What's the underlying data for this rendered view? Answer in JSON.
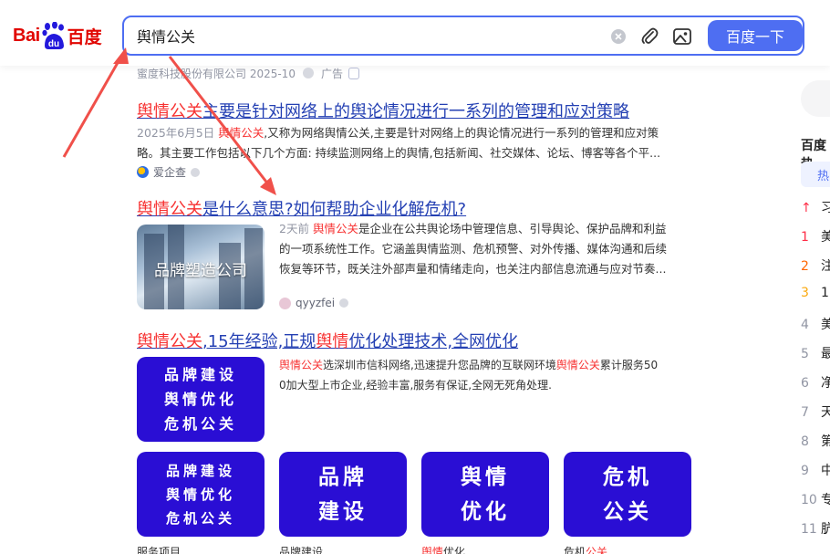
{
  "header": {
    "logo": {
      "bai": "Bai",
      "du": "du",
      "brand": "百度"
    },
    "search": {
      "value": "舆情公关"
    },
    "search_button_label": "百度一下"
  },
  "ad": {
    "company": "蜜度科技股份有限公司 2025-10",
    "ad_label": "广告"
  },
  "results": [
    {
      "title_hl": "舆情公关",
      "title_rest": "主要是针对网络上的舆论情况进行一系列的管理和应对策略",
      "snippet_line1_date": "2025年6月5日",
      "snippet_line1_hl": "舆情公关",
      "snippet_line1_rest": ",又称为网络舆情公关,主要是针对网络上的舆论情况进行一系列的管理和应对策",
      "snippet_line2": "略。其主要工作包括以下几个方面: 持续监测网络上的舆情,包括新闻、社交媒体、论坛、博客等各个平...",
      "source": "爱企查"
    },
    {
      "title_hl": "舆情公关",
      "title_rest": "是什么意思?如何帮助企业化解危机?",
      "thumb_text": "品牌塑造公司",
      "snippet_line1_date": "2天前",
      "snippet_line1_hl": "舆情公关",
      "snippet_line1_rest": "是企业在公共舆论场中管理信息、引导舆论、保护品牌和利益",
      "snippet_line2": "的一项系统性工作。它涵盖舆情监测、危机预警、对外传播、媒体沟通和后续",
      "snippet_line3": "恢复等环节，既关注外部声量和情绪走向，也关注内部信息流通与应对节奏...",
      "source": "qyyzfei"
    },
    {
      "title_hl1": "舆情公关",
      "title_mid": ",15年经验,正规",
      "title_hl2": "舆情",
      "title_rest": "优化处理技术,全网优化",
      "snippet_hl1": "舆情公关",
      "snippet_mid": "选深圳市信科网络,迅速提升您品牌的互联网环境",
      "snippet_hl2": "舆情公关",
      "snippet_rest": "累计服务50",
      "snippet_line2": "0加大型上市企业,经验丰富,服务有保证,全网无死角处理.",
      "tile_main": [
        "品牌建设",
        "舆情优化",
        "危机公关"
      ],
      "tiles": [
        {
          "lines": [
            "品牌建设",
            "舆情优化",
            "危机公关"
          ],
          "caption": "服务项目"
        },
        {
          "lines": [
            "品牌",
            "建设"
          ],
          "caption": "品牌建设"
        },
        {
          "lines": [
            "舆情",
            "优化"
          ],
          "caption_hl": "舆情",
          "caption_rest": "优化"
        },
        {
          "lines": [
            "危机",
            "公关"
          ],
          "caption_pre": "危机",
          "caption_hl": "公关"
        }
      ]
    }
  ],
  "sidebar": {
    "title": "百度热",
    "tab": "热",
    "ranks": [
      {
        "n": "",
        "t": "习"
      },
      {
        "n": "1",
        "t": "美"
      },
      {
        "n": "2",
        "t": "注"
      },
      {
        "n": "3",
        "t": "1"
      },
      {
        "n": "4",
        "t": "美"
      },
      {
        "n": "5",
        "t": "最"
      },
      {
        "n": "6",
        "t": "净"
      },
      {
        "n": "7",
        "t": "天"
      },
      {
        "n": "8",
        "t": "第"
      },
      {
        "n": "9",
        "t": "中"
      },
      {
        "n": "10",
        "t": "专"
      },
      {
        "n": "11",
        "t": "肮"
      }
    ]
  },
  "colors": {
    "accent": "#4e6ef2",
    "brand_red": "#e10601",
    "highlight": "#f73131",
    "tile": "#2a0ed4",
    "annotation_arrow": "#f0504a"
  }
}
